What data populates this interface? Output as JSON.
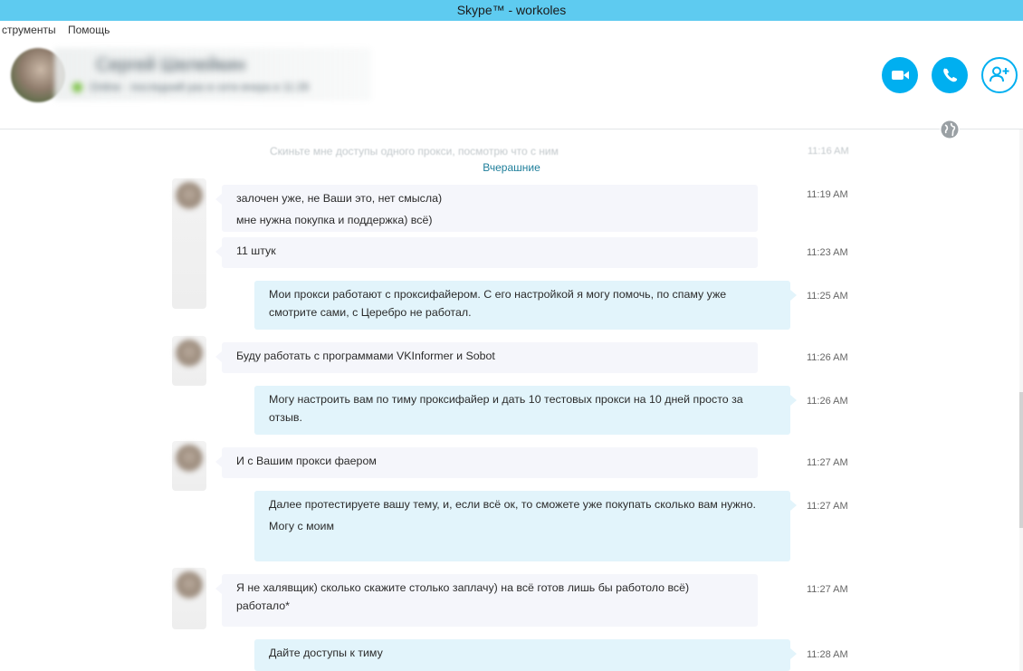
{
  "window": {
    "title": "Skype™ - workoles"
  },
  "menu": {
    "items": [
      "струменты",
      "Помощь"
    ]
  },
  "contact": {
    "name": "Сергей Шелейкин",
    "status": "Online · последний раз в сети вчера в 11:28"
  },
  "accent_color": "#00aff0",
  "faded_message": {
    "text": "Скиньте мне доступы одного прокси, посмотрю что с ним",
    "time": "11:16 AM"
  },
  "date_separator": "Вчерашние",
  "messages": [
    {
      "direction": "in",
      "lines": [
        "залочен уже, не Ваши это, нет смысла)",
        "мне нужна покупка и поддержка) всё)"
      ],
      "time": "11:19 AM"
    },
    {
      "direction": "in",
      "lines": [
        "11 штук"
      ],
      "time": "11:23 AM"
    },
    {
      "direction": "out",
      "lines": [
        "Мои прокси работают с проксифайером. С его настройкой я могу помочь, по спаму уже смотрите сами, с Церебро не работал."
      ],
      "time": "11:25 AM"
    },
    {
      "direction": "in",
      "lines": [
        "Буду работать с программами VKInformer и Sobot"
      ],
      "time": "11:26 AM"
    },
    {
      "direction": "out",
      "lines": [
        "Могу настроить вам по тиму проксифайер и дать 10 тестовых прокси на 10 дней просто за отзыв."
      ],
      "time": "11:26 AM"
    },
    {
      "direction": "in",
      "lines": [
        "И с Вашим прокси фаером"
      ],
      "time": "11:27 AM"
    },
    {
      "direction": "out",
      "lines": [
        "Далее протестируете вашу тему, и, если всё ок, то сможете уже покупать сколько вам нужно.",
        "Могу с моим"
      ],
      "time": "11:27 AM"
    },
    {
      "direction": "in",
      "lines": [
        "Я не халявщик) сколько скажите столько заплачу) на всё готов лишь бы работоло всё) работало*"
      ],
      "time": "11:27 AM"
    },
    {
      "direction": "out",
      "lines": [
        "Дайте доступы к тиму"
      ],
      "time": "11:28 AM"
    }
  ]
}
